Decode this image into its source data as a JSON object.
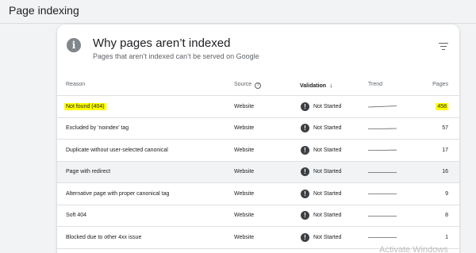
{
  "page": {
    "title": "Page indexing"
  },
  "card": {
    "title": "Why pages aren’t indexed",
    "subtitle": "Pages that aren’t indexed can’t be served on Google",
    "info_icon": "info-icon",
    "filter_icon": "filter-icon"
  },
  "table": {
    "headers": {
      "reason": "Reason",
      "source": "Source",
      "validation": "Validation",
      "trend": "Trend",
      "pages": "Pages"
    },
    "rows": [
      {
        "reason": "Not found (404)",
        "source": "Website",
        "validation": "Not Started",
        "pages": "458",
        "highlighted": true
      },
      {
        "reason": "Excluded by ‘noindex’ tag",
        "source": "Website",
        "validation": "Not Started",
        "pages": "57"
      },
      {
        "reason": "Duplicate without user-selected canonical",
        "source": "Website",
        "validation": "Not Started",
        "pages": "17"
      },
      {
        "reason": "Page with redirect",
        "source": "Website",
        "validation": "Not Started",
        "pages": "16",
        "hovered": true
      },
      {
        "reason": "Alternative page with proper canonical tag",
        "source": "Website",
        "validation": "Not Started",
        "pages": "9"
      },
      {
        "reason": "Soft 404",
        "source": "Website",
        "validation": "Not Started",
        "pages": "8"
      },
      {
        "reason": "Blocked due to other 4xx issue",
        "source": "Website",
        "validation": "Not Started",
        "pages": "1"
      }
    ]
  },
  "colors": {
    "highlight": "#ffff00",
    "hover_row": "#f1f3f4"
  },
  "watermark": "Activate Windows"
}
